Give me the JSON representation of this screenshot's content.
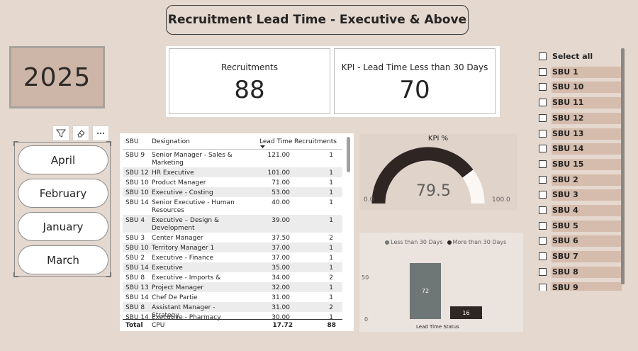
{
  "title": "Recruitment Lead Time - Executive & Above",
  "year": "2025",
  "kpis": {
    "recruitments_label": "Recruitments",
    "recruitments_value": "88",
    "kpi_label": "KPI - Lead Time Less than 30 Days",
    "kpi_value": "70"
  },
  "month_slicer": {
    "items": [
      "April",
      "February",
      "January",
      "March"
    ]
  },
  "table": {
    "headers": [
      "SBU",
      "Designation",
      "Lead Time",
      "Recruitments"
    ],
    "rows": [
      [
        "SBU 9",
        "Senior Manager - Sales & Marketing",
        "121.00",
        "1"
      ],
      [
        "SBU 12",
        "HR Executive",
        "101.00",
        "1"
      ],
      [
        "SBU 10",
        "Product Manager",
        "71.00",
        "1"
      ],
      [
        "SBU 10",
        "Executive - Costing",
        "53.00",
        "1"
      ],
      [
        "SBU 14",
        "Senior Executive - Human Resources",
        "40.00",
        "1"
      ],
      [
        "SBU 4",
        "Executive – Design & Development",
        "39.00",
        "1"
      ],
      [
        "SBU 3",
        "Center Manager",
        "37.50",
        "2"
      ],
      [
        "SBU 10",
        "Territory Manager 1",
        "37.00",
        "1"
      ],
      [
        "SBU 2",
        "Executive - Finance",
        "37.00",
        "1"
      ],
      [
        "SBU 14",
        "Executive",
        "35.00",
        "1"
      ],
      [
        "SBU 8",
        "Executive - Imports & Exports",
        "34.00",
        "2"
      ],
      [
        "SBU 13",
        "Project Manager",
        "32.00",
        "1"
      ],
      [
        "SBU 14",
        "Chef De Partie",
        "31.00",
        "1"
      ],
      [
        "SBU 8",
        "Assistant Manager - Strategy",
        "31.00",
        "2"
      ],
      [
        "SBU 14",
        "Executive - Pharmacy CPU",
        "30.00",
        "1"
      ]
    ],
    "total": [
      "Total",
      "17.72",
      "88"
    ]
  },
  "gauge": {
    "title": "KPI %",
    "value": "79.5",
    "min": "0.0",
    "max": "100.0",
    "fraction": 0.795
  },
  "column_chart": {
    "legend": [
      "Less than 30 Days",
      "More than 30 Days"
    ],
    "colors": [
      "#6e7676",
      "#302624"
    ],
    "ticks": [
      "50",
      "0"
    ],
    "xlabel": "Lead Time Status",
    "bar_labels": [
      "72",
      "16"
    ]
  },
  "chart_data": {
    "type": "bar",
    "categories": [
      "Lead Time Status"
    ],
    "series": [
      {
        "name": "Less than 30 Days",
        "values": [
          72
        ]
      },
      {
        "name": "More than 30 Days",
        "values": [
          16
        ]
      }
    ],
    "xlabel": "Lead Time Status",
    "ylabel": "",
    "y_ticks": [
      0,
      50
    ],
    "legend_position": "top"
  },
  "sbu_slicer": {
    "items": [
      "Select all",
      "SBU 1",
      "SBU 10",
      "SBU 11",
      "SBU 12",
      "SBU 13",
      "SBU 14",
      "SBU 15",
      "SBU 2",
      "SBU 3",
      "SBU 4",
      "SBU 5",
      "SBU 6",
      "SBU 7",
      "SBU 8",
      "SBU 9"
    ]
  }
}
